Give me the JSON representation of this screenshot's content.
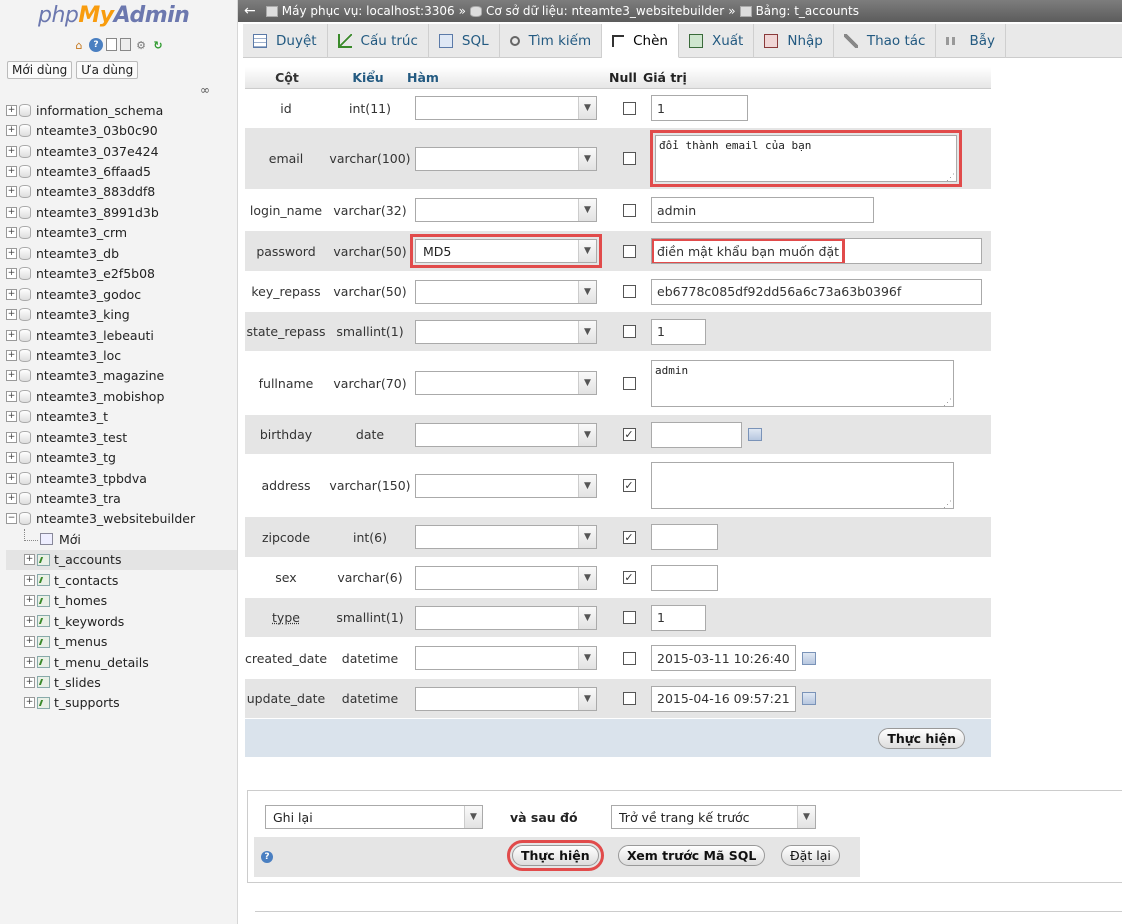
{
  "app": {
    "logo_php": "php",
    "logo_my": "My",
    "logo_admin": "Admin"
  },
  "nav": {
    "recent_label": "Mới dùng",
    "favorites_label": "Ưa dùng",
    "databases": [
      "information_schema",
      "nteamte3_03b0c90",
      "nteamte3_037e424",
      "nteamte3_6ffaad5",
      "nteamte3_883ddf8",
      "nteamte3_8991d3b",
      "nteamte3_crm",
      "nteamte3_db",
      "nteamte3_e2f5b08",
      "nteamte3_godoc",
      "nteamte3_king",
      "nteamte3_lebeauti",
      "nteamte3_loc",
      "nteamte3_magazine",
      "nteamte3_mobishop",
      "nteamte3_t",
      "nteamte3_test",
      "nteamte3_tg",
      "nteamte3_tpbdva",
      "nteamte3_tra",
      "nteamte3_websitebuilder"
    ],
    "new_label": "Mới",
    "tables": [
      "t_accounts",
      "t_contacts",
      "t_homes",
      "t_keywords",
      "t_menus",
      "t_menu_details",
      "t_slides",
      "t_supports"
    ]
  },
  "breadcrumb": {
    "server": "Máy phục vụ: localhost:3306",
    "database": "Cơ sở dữ liệu: nteamte3_websitebuilder",
    "table": "Bảng: t_accounts",
    "sep": "»"
  },
  "tabs": [
    "Duyệt",
    "Cấu trúc",
    "SQL",
    "Tìm kiếm",
    "Chèn",
    "Xuất",
    "Nhập",
    "Thao tác",
    "Bẫy"
  ],
  "headers": {
    "column": "Cột",
    "type": "Kiểu",
    "function": "Hàm",
    "null": "Null",
    "value": "Giá trị"
  },
  "rows": [
    {
      "name": "id",
      "type": "int(11)",
      "func": "",
      "null": false,
      "value": "1"
    },
    {
      "name": "email",
      "type": "varchar(100)",
      "func": "",
      "null": false,
      "value": "đổi thành email của bạn"
    },
    {
      "name": "login_name",
      "type": "varchar(32)",
      "func": "",
      "null": false,
      "value": "admin"
    },
    {
      "name": "password",
      "type": "varchar(50)",
      "func": "MD5",
      "null": false,
      "value": "điền mật khẩu bạn muốn đặt"
    },
    {
      "name": "key_repass",
      "type": "varchar(50)",
      "func": "",
      "null": false,
      "value": "eb6778c085df92dd56a6c73a63b0396f"
    },
    {
      "name": "state_repass",
      "type": "smallint(1)",
      "func": "",
      "null": false,
      "value": "1"
    },
    {
      "name": "fullname",
      "type": "varchar(70)",
      "func": "",
      "null": false,
      "value": "admin"
    },
    {
      "name": "birthday",
      "type": "date",
      "func": "",
      "null": true,
      "value": ""
    },
    {
      "name": "address",
      "type": "varchar(150)",
      "func": "",
      "null": true,
      "value": ""
    },
    {
      "name": "zipcode",
      "type": "int(6)",
      "func": "",
      "null": true,
      "value": ""
    },
    {
      "name": "sex",
      "type": "varchar(6)",
      "func": "",
      "null": true,
      "value": ""
    },
    {
      "name": "type",
      "type": "smallint(1)",
      "func": "",
      "null": false,
      "value": "1"
    },
    {
      "name": "created_date",
      "type": "datetime",
      "func": "",
      "null": false,
      "value": "2015-03-11 10:26:40"
    },
    {
      "name": "update_date",
      "type": "datetime",
      "func": "",
      "null": false,
      "value": "2015-04-16 09:57:21"
    }
  ],
  "go_label": "Thực hiện",
  "bottom": {
    "action_select": "Ghi lại",
    "and_then": "và sau đó",
    "after_select": "Trở về trang kế trước",
    "go_label": "Thực hiện",
    "preview_label": "Xem trước Mã SQL",
    "reset_label": "Đặt lại"
  },
  "colors": {
    "highlight": "#e14b4b",
    "link": "#235a81",
    "row_alt": "#e5e5e5"
  }
}
